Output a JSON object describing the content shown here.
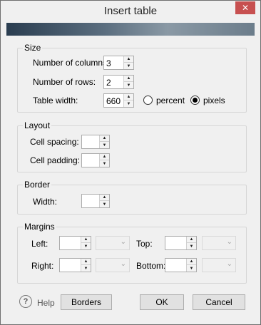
{
  "window": {
    "title": "Insert table",
    "close_glyph": "✕"
  },
  "size_group": {
    "legend": "Size",
    "columns_label": "Number of columns:",
    "columns_value": "3",
    "rows_label": "Number of rows:",
    "rows_value": "2",
    "width_label": "Table width:",
    "width_value": "660",
    "unit_options": [
      "percent",
      "pixels"
    ],
    "unit_selected": "pixels"
  },
  "layout_group": {
    "legend": "Layout",
    "spacing_label": "Cell spacing:",
    "spacing_value": "",
    "padding_label": "Cell padding:",
    "padding_value": ""
  },
  "border_group": {
    "legend": "Border",
    "width_label": "Width:",
    "width_value": ""
  },
  "margins_group": {
    "legend": "Margins",
    "left_label": "Left:",
    "top_label": "Top:",
    "right_label": "Right:",
    "bottom_label": "Bottom:"
  },
  "footer": {
    "help_glyph": "?",
    "help_label": "Help",
    "borders_label": "Borders",
    "ok_label": "OK",
    "cancel_label": "Cancel"
  },
  "icons": {
    "spin_up": "▲",
    "spin_down": "▼",
    "combo_chevron": "⌄"
  },
  "colors": {
    "close_button": "#c75050",
    "banner_dark": "#2a3d50",
    "banner_light": "#8a99a5"
  }
}
